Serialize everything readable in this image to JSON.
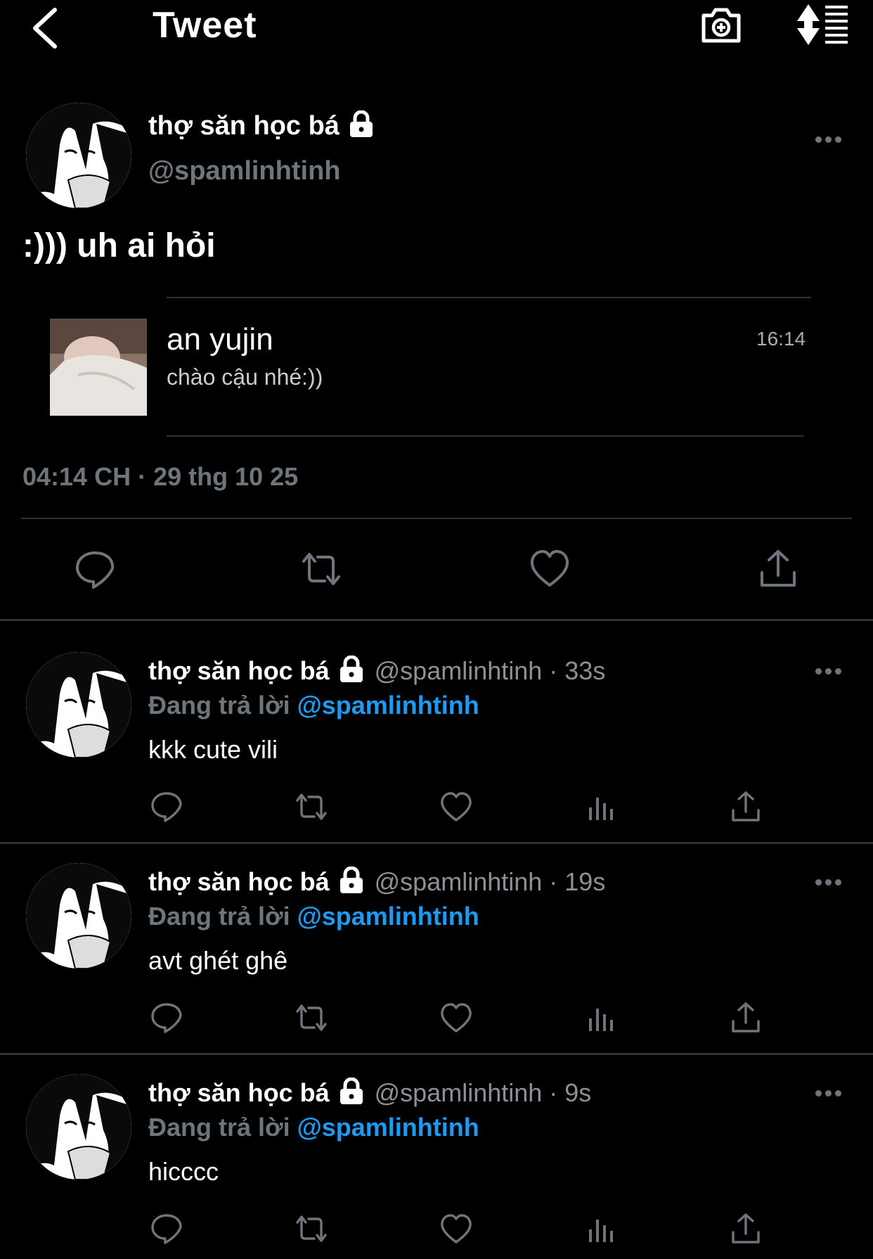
{
  "header": {
    "title": "Tweet",
    "back_icon": "chevron-left-icon",
    "camera_icon": "camera-plus-icon",
    "sort_icon": "sort-list-icon"
  },
  "main_tweet": {
    "display_name": "thợ săn học bá",
    "handle": "@spamlinhtinh",
    "text": ":))) uh ai hỏi",
    "quote": {
      "name": "an yujin",
      "message": "chào cậu nhé:))",
      "time": "16:14"
    },
    "timestamp": "04:14 CH · 29 thg 10 25"
  },
  "replies": [
    {
      "display_name": "thợ săn học bá",
      "meta": "@spamlinhtinh · 33s",
      "replying_label": "Đang trả lời",
      "replying_to": "@spamlinhtinh",
      "text": "kkk cute vili"
    },
    {
      "display_name": "thợ săn học bá",
      "meta": "@spamlinhtinh · 19s",
      "replying_label": "Đang trả lời",
      "replying_to": "@spamlinhtinh",
      "text": "avt ghét ghê"
    },
    {
      "display_name": "thợ săn học bá",
      "meta": "@spamlinhtinh · 9s",
      "replying_label": "Đang trả lời",
      "replying_to": "@spamlinhtinh",
      "text": "hicccc"
    }
  ],
  "colors": {
    "background": "#000000",
    "muted": "#6e767d",
    "mention": "#1d9bf0",
    "divider": "#2f3336"
  }
}
